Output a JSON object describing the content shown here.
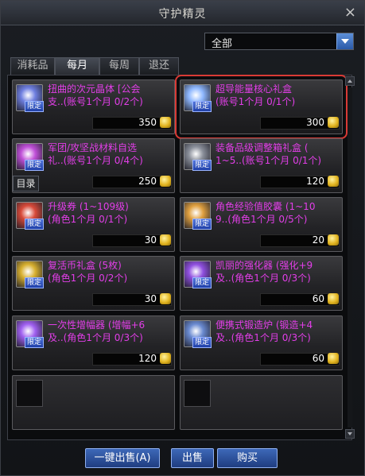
{
  "window": {
    "title": "守护精灵",
    "close_glyph": "×"
  },
  "filter": {
    "selected": "全部"
  },
  "tabs": [
    {
      "label": "消耗品",
      "active": false
    },
    {
      "label": "每月",
      "active": true
    },
    {
      "label": "每周",
      "active": false
    },
    {
      "label": "退还",
      "active": false
    }
  ],
  "catalog_tag": "目录",
  "items": [
    {
      "name": "扭曲的次元晶体 [公会",
      "limit": "支..(账号1个月 0/2个)",
      "price": "350",
      "badge": "限定",
      "icon": "crystal-box-icon",
      "icon_color": "#6f7fe0"
    },
    {
      "name": "超导能量核心礼盒",
      "limit": "(账号1个月 0/1个)",
      "price": "300",
      "badge": "限定",
      "icon": "energy-core-box-icon",
      "icon_color": "#8fb8ff",
      "selected": true
    },
    {
      "name": "军团/攻坚战材料自选",
      "limit": "礼..(账号1个月 0/4个)",
      "price": "250",
      "badge": "限定",
      "icon": "material-box-icon",
      "icon_color": "#c050d8"
    },
    {
      "name": "装备品级调整箱礼盒 (",
      "limit": "1~5..(账号1个月 0/1个)",
      "price": "120",
      "badge": "限定",
      "icon": "equipment-box-icon",
      "icon_color": "#8a8f9a"
    },
    {
      "name": "升级券 (1~109级)",
      "limit": "(角色1个月 0/1个)",
      "price": "30",
      "badge": "限定",
      "icon": "level-ticket-icon",
      "icon_color": "#d84a3a"
    },
    {
      "name": "角色经验值胶囊 (1~10",
      "limit": "9..(角色1个月 0/5个)",
      "price": "20",
      "badge": "限定",
      "icon": "exp-capsule-icon",
      "icon_color": "#e0a040"
    },
    {
      "name": "复活币礼盒 (5枚)",
      "limit": "(角色1个月 0/2个)",
      "price": "30",
      "badge": "限定",
      "icon": "revive-coin-icon",
      "icon_color": "#d8b030"
    },
    {
      "name": "凯丽的强化器 (强化+9",
      "limit": "及..(角色1个月 0/3个)",
      "price": "60",
      "badge": "限定",
      "icon": "enhancer-icon",
      "icon_color": "#9050e0"
    },
    {
      "name": "一次性增幅器 (增幅+6",
      "limit": "及..(角色1个月 0/3个)",
      "price": "120",
      "badge": "限定",
      "icon": "amplifier-icon",
      "icon_color": "#a060f0"
    },
    {
      "name": "便携式锻造炉 (锻造+4",
      "limit": "及..(角色1个月 0/3个)",
      "price": "60",
      "badge": "限定",
      "icon": "forge-icon",
      "icon_color": "#6a8ad0"
    }
  ],
  "buttons": {
    "sell_all": "一键出售(A)",
    "sell": "出售",
    "buy": "购买"
  },
  "colors": {
    "item_name": "#e23ee8",
    "selection": "#d93a35",
    "button": "#2f57a8"
  }
}
